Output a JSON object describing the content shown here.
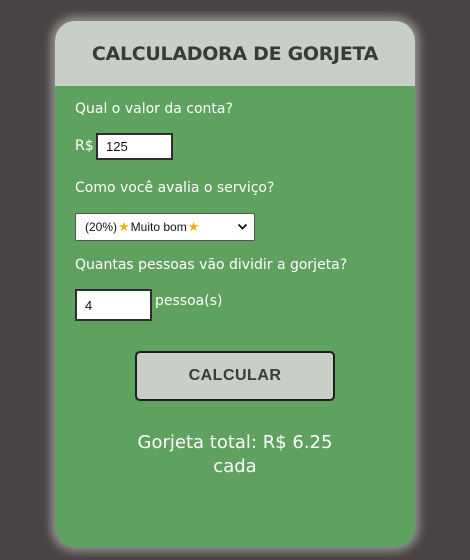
{
  "calculator": {
    "title": "CALCULADORA DE GORJETA",
    "bill": {
      "question": "Qual o valor da conta?",
      "currency": "R$",
      "value": "125"
    },
    "service": {
      "question": "Como você avalia o serviço?",
      "selected_text": "(20%)",
      "selected_star_icon": "star-icon",
      "selected_label": "Muito bom"
    },
    "people": {
      "question": "Quantas pessoas vão dividir a gorjeta?",
      "value": "4",
      "unit": "pessoa(s)"
    },
    "calculate_label": "CALCULAR",
    "result": {
      "line1": "Gorjeta total: R$ 6.25",
      "line2": "cada"
    }
  },
  "colors": {
    "background": "#484242",
    "card": "#5fa15e",
    "header": "#c8cfc6",
    "button": "#c8cfc6",
    "star": "#e8b400"
  }
}
